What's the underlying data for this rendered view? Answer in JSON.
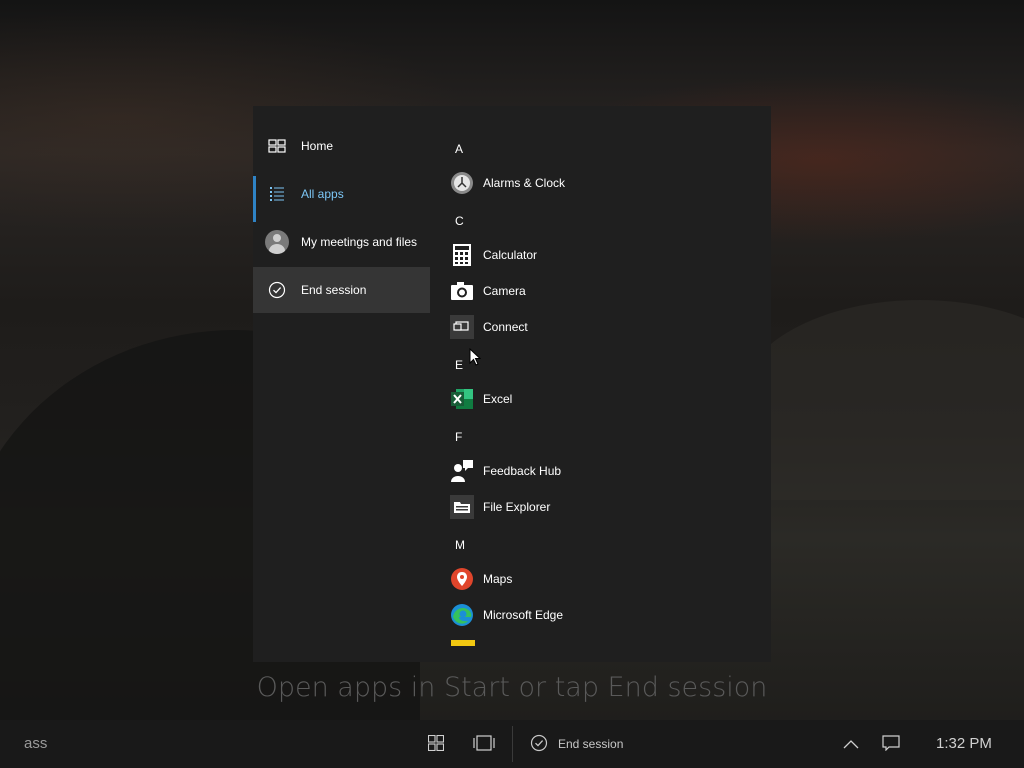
{
  "nav": {
    "home_label": "Home",
    "allapps_label": "All apps",
    "meetings_label": "My meetings and files",
    "end_label": "End session"
  },
  "apps": {
    "letter_a": "A",
    "alarms": "Alarms & Clock",
    "letter_c": "C",
    "calculator": "Calculator",
    "camera": "Camera",
    "connect": "Connect",
    "letter_e": "E",
    "excel": "Excel",
    "letter_f": "F",
    "feedback": "Feedback Hub",
    "explorer": "File Explorer",
    "letter_m": "M",
    "maps": "Maps",
    "edge": "Microsoft Edge"
  },
  "hint": "Open apps in Start or tap End session",
  "taskbar": {
    "search_text": "ass",
    "end_session_label": "End session",
    "time": "1:32 PM"
  },
  "colors": {
    "accent": "#2f83c5",
    "active_text": "#7cc6f5",
    "menu_bg": "#1f1f1f",
    "taskbar_bg": "#191919"
  }
}
